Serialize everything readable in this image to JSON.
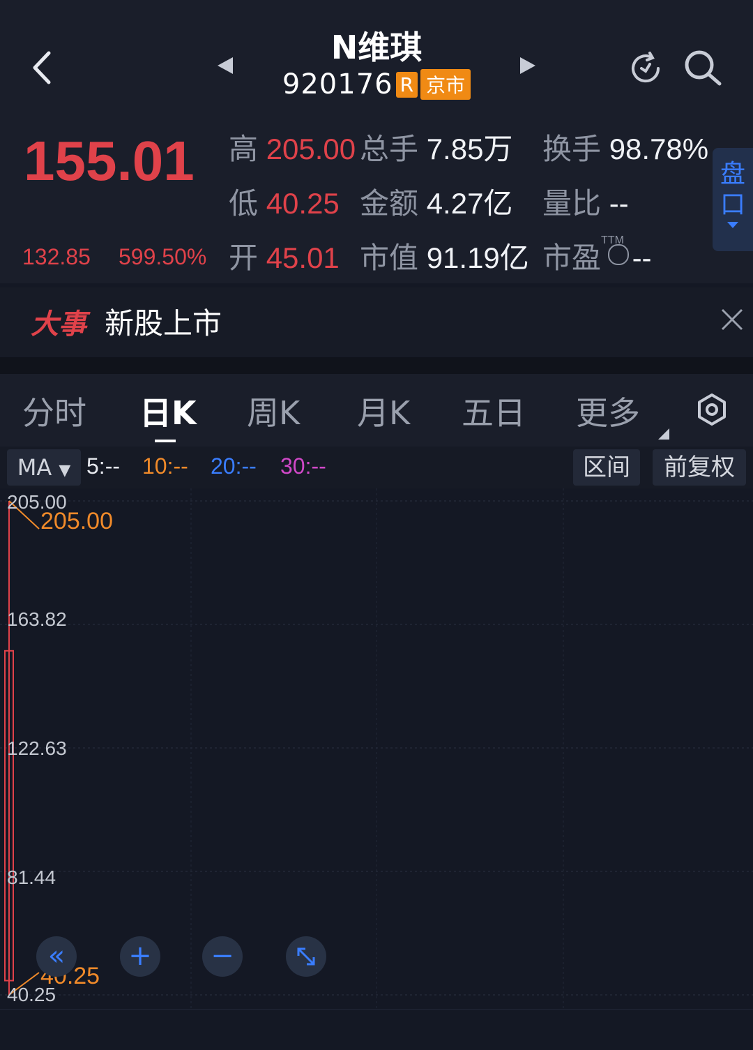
{
  "header": {
    "title": "N维琪",
    "code": "920176",
    "badge_r": "R",
    "badge_market": "京市"
  },
  "quote": {
    "price": "155.01",
    "change": "132.85",
    "change_pct": "599.50%",
    "rows": [
      [
        {
          "label": "高",
          "value": "205.00"
        },
        {
          "label": "总手",
          "value": "7.85万"
        },
        {
          "label": "换手",
          "value": "98.78%"
        }
      ],
      [
        {
          "label": "低",
          "value": "40.25"
        },
        {
          "label": "金额",
          "value": "4.27亿"
        },
        {
          "label": "量比",
          "value": "--"
        }
      ],
      [
        {
          "label": "开",
          "value": "45.01"
        },
        {
          "label": "市值",
          "value": "91.19亿"
        },
        {
          "label": "市盈",
          "value": "--"
        }
      ]
    ],
    "ttm": "TTM",
    "pankou": "盘口"
  },
  "event": {
    "tag": "大事",
    "text": "新股上市"
  },
  "tabs": [
    "分时",
    "日K",
    "周K",
    "月K",
    "五日",
    "更多"
  ],
  "active_tab": "日K",
  "ma": {
    "label": "MA",
    "items": [
      {
        "text": "5:--",
        "color": "#e6e8ee"
      },
      {
        "text": "10:--",
        "color": "#f08a2a"
      },
      {
        "text": "20:--",
        "color": "#3a7dff"
      },
      {
        "text": "30:--",
        "color": "#d048c8"
      }
    ],
    "range_btn": "区间",
    "adjust_btn": "前复权"
  },
  "chart": {
    "y_ticks": [
      "205.00",
      "163.82",
      "122.63",
      "81.44",
      "40.25"
    ],
    "high_marker": "205.00",
    "low_marker": "40.25"
  },
  "chart_data": {
    "type": "candlestick",
    "ylim": [
      40.25,
      205.0
    ],
    "candles": [
      {
        "open": 45.01,
        "high": 205.0,
        "low": 40.25,
        "close": 155.01
      }
    ]
  },
  "icons": [
    "back-icon",
    "prev-icon",
    "next-icon",
    "refresh-icon",
    "search-icon",
    "close-icon",
    "settings-icon",
    "collapse-left-icon",
    "zoom-in-icon",
    "zoom-out-icon",
    "fullscreen-icon"
  ]
}
